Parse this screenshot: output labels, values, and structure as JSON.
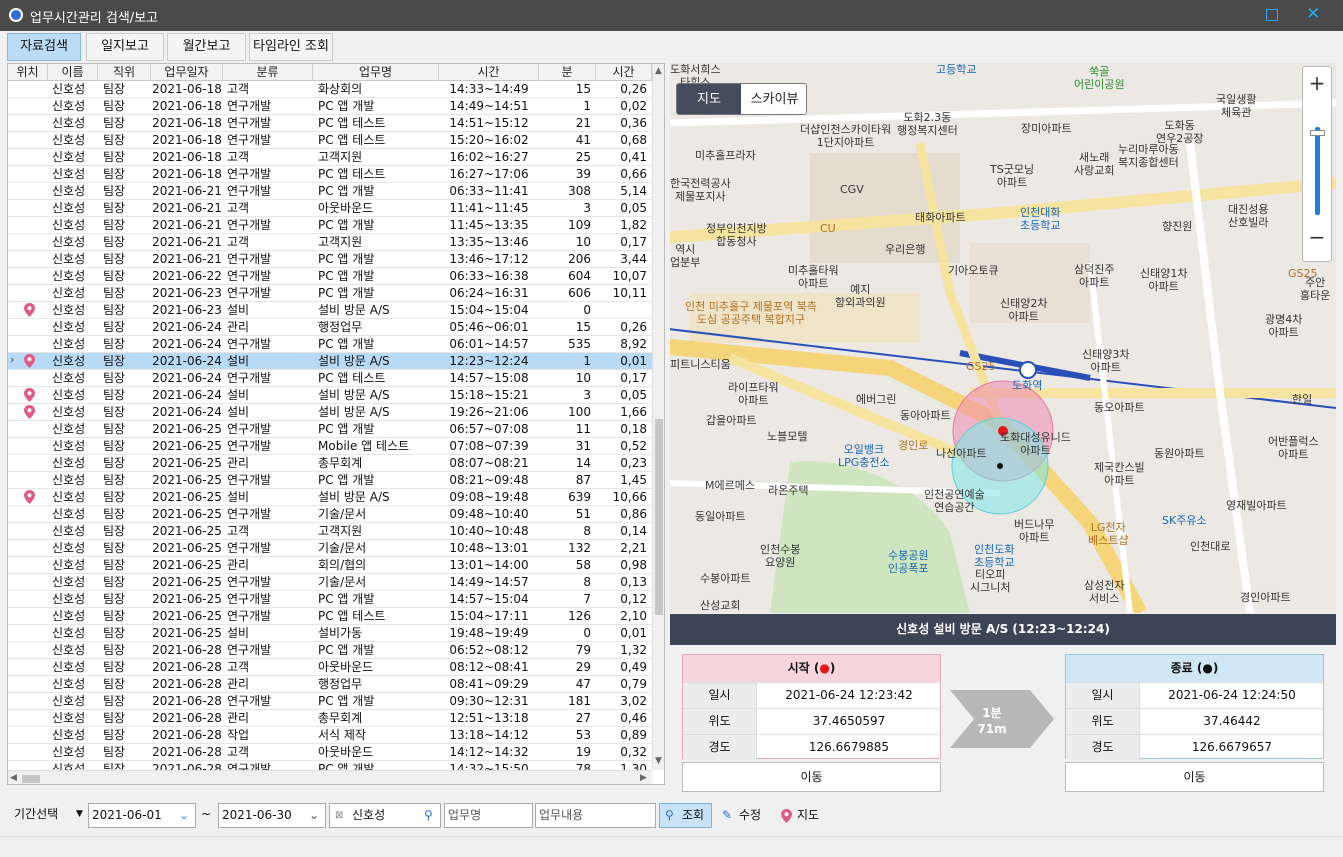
{
  "window": {
    "title": "업무시간관리 검색/보고"
  },
  "tabs": [
    "자료검색",
    "일지보고",
    "월간보고",
    "타임라인 조회"
  ],
  "grid": {
    "columns": [
      "위치",
      "이름",
      "직위",
      "업무일자",
      "분류",
      "업무명",
      "시간",
      "분",
      "시간"
    ],
    "rows": [
      [
        "",
        "신호성",
        "팀장",
        "2021-06-18",
        "고객",
        "화상회의",
        "14:33~14:49",
        "15",
        "0,26"
      ],
      [
        "",
        "신호성",
        "팀장",
        "2021-06-18",
        "연구개발",
        "PC 앱 개발",
        "14:49~14:51",
        "1",
        "0,02"
      ],
      [
        "",
        "신호성",
        "팀장",
        "2021-06-18",
        "연구개발",
        "PC 앱 테스트",
        "14:51~15:12",
        "21",
        "0,36"
      ],
      [
        "",
        "신호성",
        "팀장",
        "2021-06-18",
        "연구개발",
        "PC 앱 테스트",
        "15:20~16:02",
        "41",
        "0,68"
      ],
      [
        "",
        "신호성",
        "팀장",
        "2021-06-18",
        "고객",
        "고객지원",
        "16:02~16:27",
        "25",
        "0,41"
      ],
      [
        "",
        "신호성",
        "팀장",
        "2021-06-18",
        "연구개발",
        "PC 앱 테스트",
        "16:27~17:06",
        "39",
        "0,66"
      ],
      [
        "",
        "신호성",
        "팀장",
        "2021-06-21",
        "연구개발",
        "PC 앱 개발",
        "06:33~11:41",
        "308",
        "5,14"
      ],
      [
        "",
        "신호성",
        "팀장",
        "2021-06-21",
        "고객",
        "아웃바운드",
        "11:41~11:45",
        "3",
        "0,05"
      ],
      [
        "",
        "신호성",
        "팀장",
        "2021-06-21",
        "연구개발",
        "PC 앱 개발",
        "11:45~13:35",
        "109",
        "1,82"
      ],
      [
        "",
        "신호성",
        "팀장",
        "2021-06-21",
        "고객",
        "고객지원",
        "13:35~13:46",
        "10",
        "0,17"
      ],
      [
        "",
        "신호성",
        "팀장",
        "2021-06-21",
        "연구개발",
        "PC 앱 개발",
        "13:46~17:12",
        "206",
        "3,44"
      ],
      [
        "",
        "신호성",
        "팀장",
        "2021-06-22",
        "연구개발",
        "PC 앱 개발",
        "06:33~16:38",
        "604",
        "10,07"
      ],
      [
        "",
        "신호성",
        "팀장",
        "2021-06-23",
        "연구개발",
        "PC 앱 개발",
        "06:24~16:31",
        "606",
        "10,11"
      ],
      [
        "pin",
        "신호성",
        "팀장",
        "2021-06-23",
        "설비",
        "설비 방문 A/S",
        "15:04~15:04",
        "0",
        ""
      ],
      [
        "",
        "신호성",
        "팀장",
        "2021-06-24",
        "관리",
        "행정업무",
        "05:46~06:01",
        "15",
        "0,26"
      ],
      [
        "",
        "신호성",
        "팀장",
        "2021-06-24",
        "연구개발",
        "PC 앱 개발",
        "06:01~14:57",
        "535",
        "8,92"
      ],
      [
        "pin",
        "신호성",
        "팀장",
        "2021-06-24",
        "설비",
        "설비 방문 A/S",
        "12:23~12:24",
        "1",
        "0,01"
      ],
      [
        "",
        "신호성",
        "팀장",
        "2021-06-24",
        "연구개발",
        "PC 앱 테스트",
        "14:57~15:08",
        "10",
        "0,17"
      ],
      [
        "pin",
        "신호성",
        "팀장",
        "2021-06-24",
        "설비",
        "설비 방문 A/S",
        "15:18~15:21",
        "3",
        "0,05"
      ],
      [
        "pin",
        "신호성",
        "팀장",
        "2021-06-24",
        "설비",
        "설비 방문 A/S",
        "19:26~21:06",
        "100",
        "1,66"
      ],
      [
        "",
        "신호성",
        "팀장",
        "2021-06-25",
        "연구개발",
        "PC 앱 개발",
        "06:57~07:08",
        "11",
        "0,18"
      ],
      [
        "",
        "신호성",
        "팀장",
        "2021-06-25",
        "연구개발",
        "Mobile 앱 테스트",
        "07:08~07:39",
        "31",
        "0,52"
      ],
      [
        "",
        "신호성",
        "팀장",
        "2021-06-25",
        "관리",
        "총무회계",
        "08:07~08:21",
        "14",
        "0,23"
      ],
      [
        "",
        "신호성",
        "팀장",
        "2021-06-25",
        "연구개발",
        "PC 앱 개발",
        "08:21~09:48",
        "87",
        "1,45"
      ],
      [
        "pin",
        "신호성",
        "팀장",
        "2021-06-25",
        "설비",
        "설비 방문 A/S",
        "09:08~19:48",
        "639",
        "10,66"
      ],
      [
        "",
        "신호성",
        "팀장",
        "2021-06-25",
        "연구개발",
        "기술/문서",
        "09:48~10:40",
        "51",
        "0,86"
      ],
      [
        "",
        "신호성",
        "팀장",
        "2021-06-25",
        "고객",
        "고객지원",
        "10:40~10:48",
        "8",
        "0,14"
      ],
      [
        "",
        "신호성",
        "팀장",
        "2021-06-25",
        "연구개발",
        "기술/문서",
        "10:48~13:01",
        "132",
        "2,21"
      ],
      [
        "",
        "신호성",
        "팀장",
        "2021-06-25",
        "관리",
        "회의/협의",
        "13:01~14:00",
        "58",
        "0,98"
      ],
      [
        "",
        "신호성",
        "팀장",
        "2021-06-25",
        "연구개발",
        "기술/문서",
        "14:49~14:57",
        "8",
        "0,13"
      ],
      [
        "",
        "신호성",
        "팀장",
        "2021-06-25",
        "연구개발",
        "PC 앱 개발",
        "14:57~15:04",
        "7",
        "0,12"
      ],
      [
        "",
        "신호성",
        "팀장",
        "2021-06-25",
        "연구개발",
        "PC 앱 테스트",
        "15:04~17:11",
        "126",
        "2,10"
      ],
      [
        "",
        "신호성",
        "팀장",
        "2021-06-25",
        "설비",
        "설비가동",
        "19:48~19:49",
        "0",
        "0,01"
      ],
      [
        "",
        "신호성",
        "팀장",
        "2021-06-28",
        "연구개발",
        "PC 앱 개발",
        "06:52~08:12",
        "79",
        "1,32"
      ],
      [
        "",
        "신호성",
        "팀장",
        "2021-06-28",
        "고객",
        "아웃바운드",
        "08:12~08:41",
        "29",
        "0,49"
      ],
      [
        "",
        "신호성",
        "팀장",
        "2021-06-28",
        "관리",
        "행정업무",
        "08:41~09:29",
        "47",
        "0,79"
      ],
      [
        "",
        "신호성",
        "팀장",
        "2021-06-28",
        "연구개발",
        "PC 앱 개발",
        "09:30~12:31",
        "181",
        "3,02"
      ],
      [
        "",
        "신호성",
        "팀장",
        "2021-06-28",
        "관리",
        "총무회계",
        "12:51~13:18",
        "27",
        "0,46"
      ],
      [
        "",
        "신호성",
        "팀장",
        "2021-06-28",
        "작업",
        "서식 제작",
        "13:18~14:12",
        "53",
        "0,89"
      ],
      [
        "",
        "신호성",
        "팀장",
        "2021-06-28",
        "고객",
        "아웃바운드",
        "14:12~14:32",
        "19",
        "0,32"
      ],
      [
        "",
        "신호성",
        "팀장",
        "2021-06-28",
        "연구개발",
        "PC 앱 개발",
        "14:32~15:50",
        "78",
        "1,30"
      ]
    ],
    "selected_index": 16
  },
  "map": {
    "toggle": [
      "지도",
      "스카이뷰"
    ],
    "header": "신호성 설비 방문 A/S (12:23~12:24)",
    "labels": [
      {
        "t": "도화서희스\n타힐스",
        "c": ""
      },
      {
        "t": "고등학교",
        "c": "blue"
      },
      {
        "t": "쑥골\n어린이공원",
        "c": "grn"
      },
      {
        "t": "국일생활\n체육관",
        "c": ""
      },
      {
        "t": "도화2.3동\n행정복지센터",
        "c": ""
      },
      {
        "t": "장미아파트",
        "c": ""
      },
      {
        "t": "도화동\n연우2공장",
        "c": ""
      },
      {
        "t": "더샵인천스카이타워\n1단지아파트",
        "c": ""
      },
      {
        "t": "미추홀프라자",
        "c": ""
      },
      {
        "t": "새노래\n사랑교회",
        "c": ""
      },
      {
        "t": "누리마루아동\n복지종합센터",
        "c": ""
      },
      {
        "t": "TS굿모닝\n아파트",
        "c": ""
      },
      {
        "t": "한국전력공사\n제물포지사",
        "c": ""
      },
      {
        "t": "CGV",
        "c": ""
      },
      {
        "t": "태화아파트",
        "c": ""
      },
      {
        "t": "인천대화\n초등학교",
        "c": "blue"
      },
      {
        "t": "향진원",
        "c": ""
      },
      {
        "t": "대진성용\n산호빌라",
        "c": ""
      },
      {
        "t": "정부인천지방\n합동청사",
        "c": ""
      },
      {
        "t": "CU",
        "c": "org"
      },
      {
        "t": "우리은행",
        "c": ""
      },
      {
        "t": "역시\n업분부",
        "c": ""
      },
      {
        "t": "미추홀타워\n아파트",
        "c": ""
      },
      {
        "t": "기아오토큐",
        "c": ""
      },
      {
        "t": "삼덕진주\n아파트",
        "c": ""
      },
      {
        "t": "신태양1차\n아파트",
        "c": ""
      },
      {
        "t": "GS25",
        "c": "org"
      },
      {
        "t": "주안\n홍타운",
        "c": ""
      },
      {
        "t": "예지\n항외과의원",
        "c": ""
      },
      {
        "t": "신태양2차\n아파트",
        "c": ""
      },
      {
        "t": "광명4차\n아파트",
        "c": ""
      },
      {
        "t": "인천 미추홀구 제물포역 북측\n도심 공공주택 복합지구",
        "c": "org"
      },
      {
        "t": "신태양3차\n아파트",
        "c": ""
      },
      {
        "t": "GS25",
        "c": "org"
      },
      {
        "t": "도화역",
        "c": "blue"
      },
      {
        "t": "피트니스티움",
        "c": ""
      },
      {
        "t": "라이프타워\n아파트",
        "c": ""
      },
      {
        "t": "에버그린",
        "c": ""
      },
      {
        "t": "동아아파트",
        "c": ""
      },
      {
        "t": "동오아파트",
        "c": ""
      },
      {
        "t": "한일",
        "c": ""
      },
      {
        "t": "갑을아파트",
        "c": ""
      },
      {
        "t": "노블모텔",
        "c": ""
      },
      {
        "t": "도화대성유니드\n아파트",
        "c": ""
      },
      {
        "t": "어반플럭스\n아파트",
        "c": ""
      },
      {
        "t": "오일뱅크\nLPG충전소",
        "c": "blue"
      },
      {
        "t": "경인로",
        "c": "org"
      },
      {
        "t": "나선아파트",
        "c": ""
      },
      {
        "t": "동원아파트",
        "c": ""
      },
      {
        "t": "제국칸스빌\n아파트",
        "c": ""
      },
      {
        "t": "M에르메스",
        "c": ""
      },
      {
        "t": "라온주택",
        "c": ""
      },
      {
        "t": "인천공연예술\n연습공간",
        "c": ""
      },
      {
        "t": "동일아파트",
        "c": ""
      },
      {
        "t": "영재빌아파트",
        "c": ""
      },
      {
        "t": "SK주유소",
        "c": "blue"
      },
      {
        "t": "버드나무\n아파트",
        "c": ""
      },
      {
        "t": "LG전자\n베스트샵",
        "c": "org"
      },
      {
        "t": "인천수봉\n요양원",
        "c": ""
      },
      {
        "t": "인천도화\n초등학교",
        "c": "blue"
      },
      {
        "t": "수봉공원\n인공폭포",
        "c": "blue"
      },
      {
        "t": "수봉아파트",
        "c": ""
      },
      {
        "t": "티오피\n시그니처",
        "c": ""
      },
      {
        "t": "삼성전자\n서비스",
        "c": ""
      },
      {
        "t": "경인아파트",
        "c": ""
      },
      {
        "t": "산성교회",
        "c": ""
      },
      {
        "t": "인천대로",
        "c": ""
      }
    ]
  },
  "start": {
    "title": "시작 (●)",
    "rows": [
      [
        "일시",
        "2021-06-24 12:23:42"
      ],
      [
        "위도",
        "37.4650597"
      ],
      [
        "경도",
        "126.6679885"
      ]
    ],
    "move": "이동",
    "dot_color": "#e01818"
  },
  "end": {
    "title": "종료 (●)",
    "rows": [
      [
        "일시",
        "2021-06-24 12:24:50"
      ],
      [
        "위도",
        "37.46442"
      ],
      [
        "경도",
        "126.6679657"
      ]
    ],
    "move": "이동",
    "dot_color": "#111111"
  },
  "diff": {
    "time": "1분",
    "distance": "71m"
  },
  "toolbar": {
    "period_label": "기간선택",
    "from": "2021-06-01",
    "tilde": "~",
    "to": "2021-06-30",
    "name": "신호성",
    "task_placeholder": "업무명",
    "content_placeholder": "업무내용",
    "search": "조회",
    "edit": "수정",
    "map": "지도"
  }
}
